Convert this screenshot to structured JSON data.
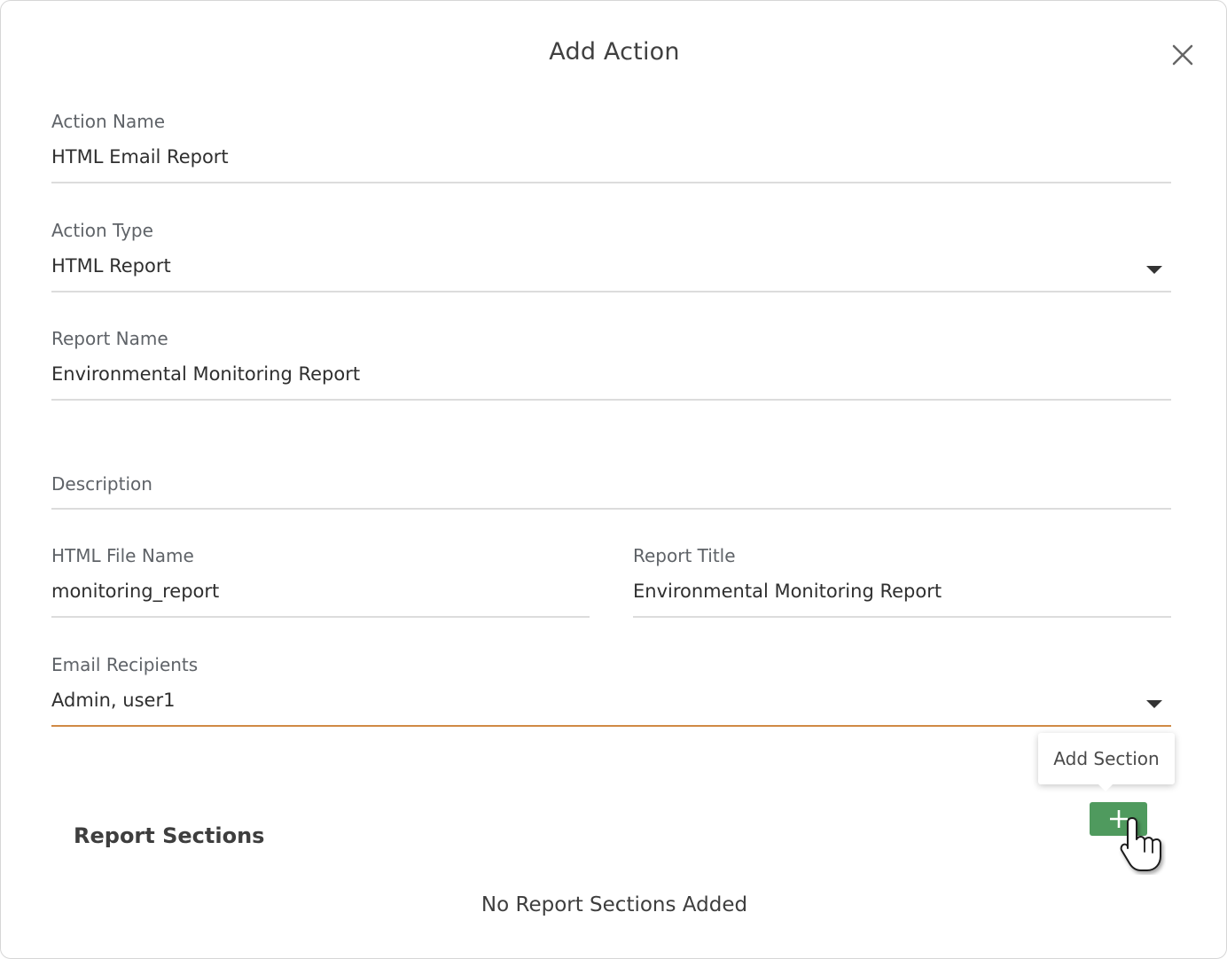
{
  "dialog": {
    "title": "Add Action"
  },
  "fields": {
    "action_name": {
      "label": "Action Name",
      "value": "HTML Email Report"
    },
    "action_type": {
      "label": "Action Type",
      "value": "HTML Report"
    },
    "report_name": {
      "label": "Report Name",
      "value": "Environmental Monitoring Report"
    },
    "description": {
      "label": "Description",
      "value": ""
    },
    "html_file_name": {
      "label": "HTML File Name",
      "value": "monitoring_report"
    },
    "report_title": {
      "label": "Report Title",
      "value": "Environmental Monitoring Report"
    },
    "email_recipients": {
      "label": "Email Recipients",
      "value": "Admin, user1"
    }
  },
  "sections": {
    "heading": "Report Sections",
    "add_tooltip": "Add Section",
    "empty_message": "No Report Sections Added"
  },
  "colors": {
    "add_button": "#4f9a5e",
    "active_underline": "#d08a45"
  },
  "icons": {
    "close": "close-icon",
    "add": "plus-icon",
    "dropdown": "dropdown-arrow-icon",
    "pointer": "hand-pointer-cursor-icon"
  }
}
